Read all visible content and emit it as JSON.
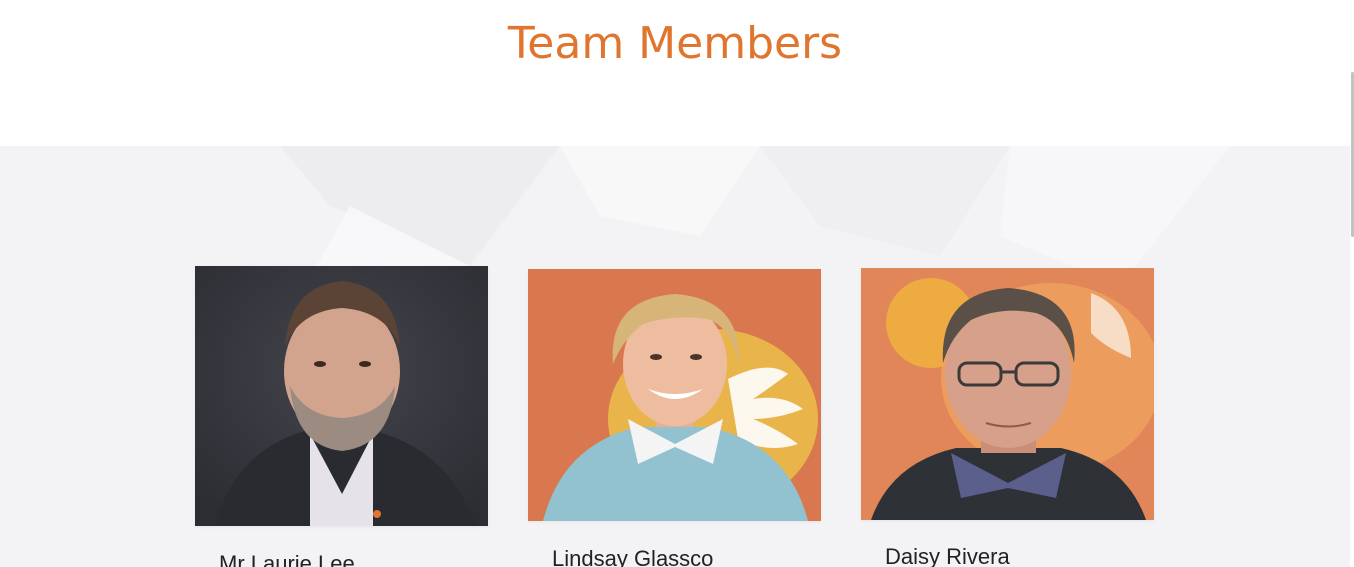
{
  "section": {
    "title": "Team Members"
  },
  "members": [
    {
      "name": "Mr Laurie Lee",
      "photo_icon": "portrait-man-dark-suit"
    },
    {
      "name": "Lindsay Glassco",
      "photo_icon": "portrait-woman-blue-sweater"
    },
    {
      "name": "Daisy Rivera",
      "photo_icon": "portrait-man-glasses"
    }
  ],
  "colors": {
    "accent": "#e0752f",
    "band_background": "#f3f3f6",
    "card_background": "#ffffff",
    "name_text": "#222222"
  }
}
